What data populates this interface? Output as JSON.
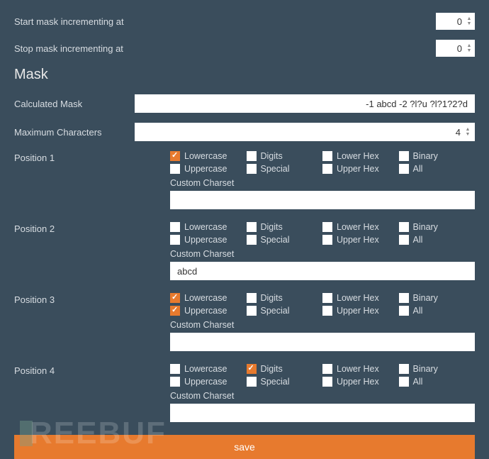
{
  "top": {
    "start_label": "Start mask incrementing at",
    "start_value": "0",
    "stop_label": "Stop mask incrementing at",
    "stop_value": "0"
  },
  "section_title": "Mask",
  "calc": {
    "label": "Calculated Mask",
    "value": "-1 abcd -2 ?l?u ?l?1?2?d"
  },
  "maxchars": {
    "label": "Maximum Characters",
    "value": "4"
  },
  "charset_labels": {
    "lowercase": "Lowercase",
    "uppercase": "Uppercase",
    "digits": "Digits",
    "special": "Special",
    "lowerhex": "Lower Hex",
    "upperhex": "Upper Hex",
    "binary": "Binary",
    "all": "All",
    "custom": "Custom Charset"
  },
  "positions": [
    {
      "label": "Position 1",
      "checks": {
        "lowercase": true,
        "uppercase": false,
        "digits": false,
        "special": false,
        "lowerhex": false,
        "upperhex": false,
        "binary": false,
        "all": false
      },
      "custom": ""
    },
    {
      "label": "Position 2",
      "checks": {
        "lowercase": false,
        "uppercase": false,
        "digits": false,
        "special": false,
        "lowerhex": false,
        "upperhex": false,
        "binary": false,
        "all": false
      },
      "custom": "abcd"
    },
    {
      "label": "Position 3",
      "checks": {
        "lowercase": true,
        "uppercase": true,
        "digits": false,
        "special": false,
        "lowerhex": false,
        "upperhex": false,
        "binary": false,
        "all": false
      },
      "custom": ""
    },
    {
      "label": "Position 4",
      "checks": {
        "lowercase": false,
        "uppercase": false,
        "digits": true,
        "special": false,
        "lowerhex": false,
        "upperhex": false,
        "binary": false,
        "all": false
      },
      "custom": ""
    }
  ],
  "save_label": "save",
  "watermark": "REEBUF"
}
